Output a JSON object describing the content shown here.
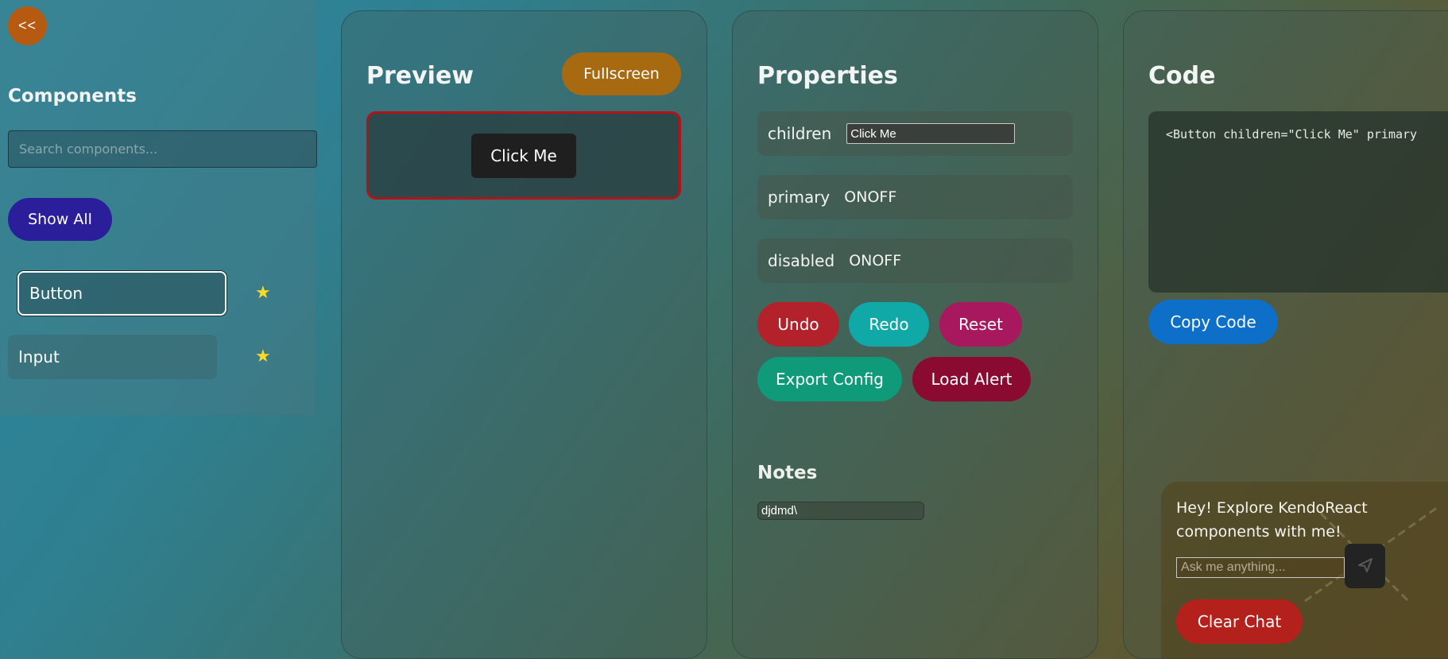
{
  "sidebar": {
    "collapse_label": "<<",
    "title": "Components",
    "search_placeholder": "Search components...",
    "show_all_label": "Show All",
    "items": [
      {
        "label": "Button",
        "selected": true,
        "favorite_icon": "star-icon"
      },
      {
        "label": "Input",
        "selected": false,
        "favorite_icon": "star-icon"
      }
    ],
    "star_glyph": "★"
  },
  "preview": {
    "title": "Preview",
    "fullscreen_label": "Fullscreen",
    "button_label": "Click Me"
  },
  "properties": {
    "title": "Properties",
    "rows": {
      "children": {
        "label": "children",
        "value": "Click Me"
      },
      "primary": {
        "label": "primary",
        "value": "ONOFF"
      },
      "disabled": {
        "label": "disabled",
        "value": "ONOFF"
      }
    },
    "buttons": {
      "undo": "Undo",
      "redo": "Redo",
      "reset": "Reset",
      "export": "Export Config",
      "load_alert": "Load Alert"
    },
    "notes_title": "Notes",
    "notes_value": "djdmd\\"
  },
  "code": {
    "title": "Code",
    "snippet": "<Button children=\"Click Me\" primary",
    "copy_label": "Copy Code"
  },
  "chat": {
    "message": "Hey! Explore KendoReact components with me!",
    "input_placeholder": "Ask me anything...",
    "send_icon": "send-icon",
    "clear_label": "Clear Chat"
  },
  "colors": {
    "collapse": "#b55a10",
    "show_all": "#2a1e9a",
    "fullscreen": "#a86a10",
    "preview_border": "#b01418",
    "undo": "#b3222a",
    "redo": "#11a8a8",
    "reset": "#a8185e",
    "export": "#0f9a7a",
    "load_alert": "#8a0a32",
    "copy": "#0d6fc7",
    "clear_chat": "#b4201c",
    "star": "#ffd824"
  }
}
